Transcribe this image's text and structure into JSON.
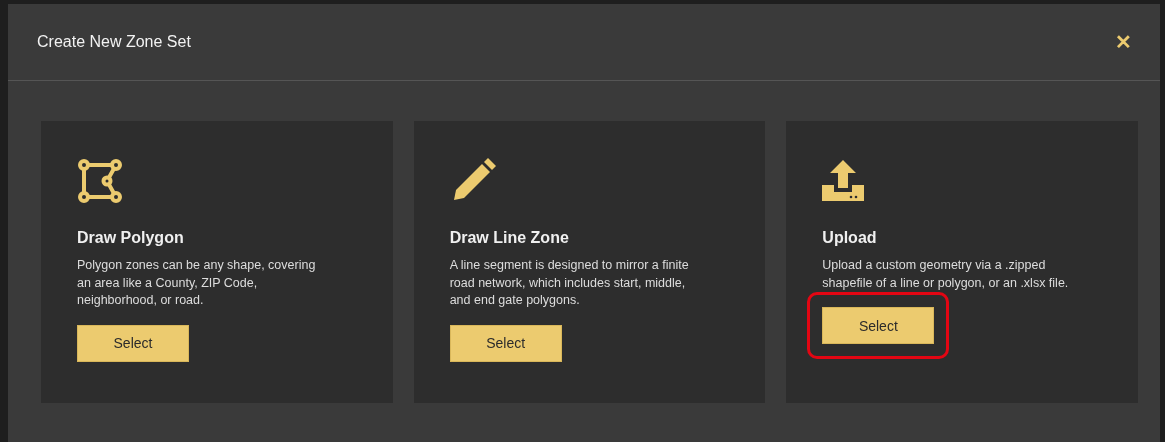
{
  "dialog": {
    "title": "Create New Zone Set",
    "close": "✕"
  },
  "options": [
    {
      "kind": "polygon",
      "title": "Draw Polygon",
      "description": "Polygon zones can be any shape, covering an area like a County, ZIP Code, neighborhood, or road.",
      "button": "Select",
      "highlighted": false
    },
    {
      "kind": "line",
      "title": "Draw Line Zone",
      "description": "A line segment is designed to mirror a finite road network, which includes start, middle, and end gate polygons.",
      "button": "Select",
      "highlighted": false
    },
    {
      "kind": "upload",
      "title": "Upload",
      "description": "Upload a custom geometry via a .zipped shapefile of a line or polygon, or an .xlsx file.",
      "button": "Select",
      "highlighted": true
    }
  ]
}
